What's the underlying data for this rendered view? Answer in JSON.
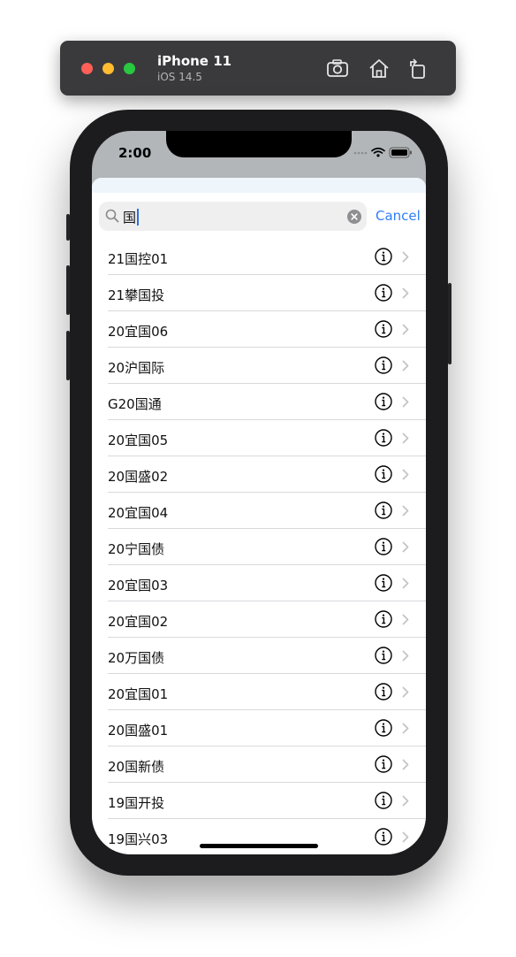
{
  "simulator": {
    "device_name": "iPhone 11",
    "os_version": "iOS 14.5",
    "toolbar_icons": [
      "screenshot-icon",
      "home-icon",
      "rotate-icon"
    ]
  },
  "status_bar": {
    "time": "2:00",
    "icons": [
      "signal-icon",
      "wifi-icon",
      "battery-icon"
    ]
  },
  "search": {
    "query": "国",
    "cancel_label": "Cancel"
  },
  "results": [
    "21国控01",
    "21攀国投",
    "20宜国06",
    "20沪国际",
    "G20国通",
    "20宜国05",
    "20国盛02",
    "20宜国04",
    "20宁国债",
    "20宜国03",
    "20宜国02",
    "20万国债",
    "20宜国01",
    "20国盛01",
    "20国新债",
    "19国开投",
    "19国兴03"
  ],
  "colors": {
    "accent": "#2f7ef5",
    "caret": "#2f6fe0",
    "simulator_bar": "#3a3a3c",
    "separator": "#d9d9dc"
  }
}
